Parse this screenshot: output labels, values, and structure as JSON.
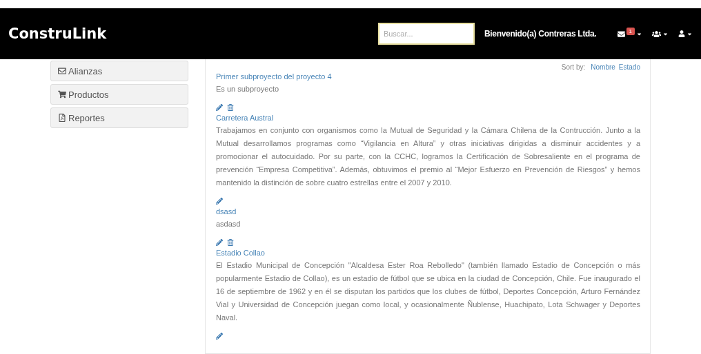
{
  "navbar": {
    "brand": "ConstruLink",
    "search": {
      "placeholder": "Buscar..."
    },
    "welcome": "Bienvenido(a) Contreras Ltda.",
    "messages_badge": "1"
  },
  "sidebar": {
    "items": [
      {
        "label": "Alianzas"
      },
      {
        "label": "Productos"
      },
      {
        "label": "Reportes"
      }
    ]
  },
  "sort": {
    "label": "Sort by:",
    "options": [
      "Nombre",
      "Estado"
    ]
  },
  "projects": [
    {
      "edit": false,
      "delete": false,
      "title": "Primer subproyecto del proyecto 4",
      "description": "Es un subproyecto"
    },
    {
      "edit": true,
      "delete": true,
      "title": "Carretera Austral",
      "description": "Trabajamos en conjunto con organismos como la Mutual de Seguridad y la Cámara Chilena de la Contrucción. Junto a la Mutual desarrollamos programas como “Vigilancia en Altura” y otras iniciativas dirigidas a disminuir accidentes y a promocionar el autocuidado. Por su parte, con la CCHC, logramos la Certificación de Sobresaliente en el programa de prevención “Empresa Competitiva”. Además, obtuvimos el premio al “Mejor Esfuerzo en Prevención de Riesgos” y hemos mantenido la distinción de sobre cuatro estrellas entre el 2007 y 2010."
    },
    {
      "edit": true,
      "delete": false,
      "title": "dsasd",
      "description": "asdasd"
    },
    {
      "edit": true,
      "delete": true,
      "title": "Estadio Collao",
      "description": "El Estadio Municipal de Concepción \"Alcaldesa Ester Roa Rebolledo\" (también llamado Estadio de Concepción o más popularmente Estadio de Collao), es un estadio de fútbol que se ubica en la ciudad de Concepción, Chile. Fue inaugurado el 16 de septiembre de 1962 y en él se disputan los partidos que los clubes de fútbol, Deportes Concepción, Arturo Fernández Vial y Universidad de Concepción juegan como local, y ocasionalmente Ñublense, Huachipato, Lota Schwager y Deportes Naval."
    },
    {
      "edit": true,
      "delete": false
    }
  ]
}
